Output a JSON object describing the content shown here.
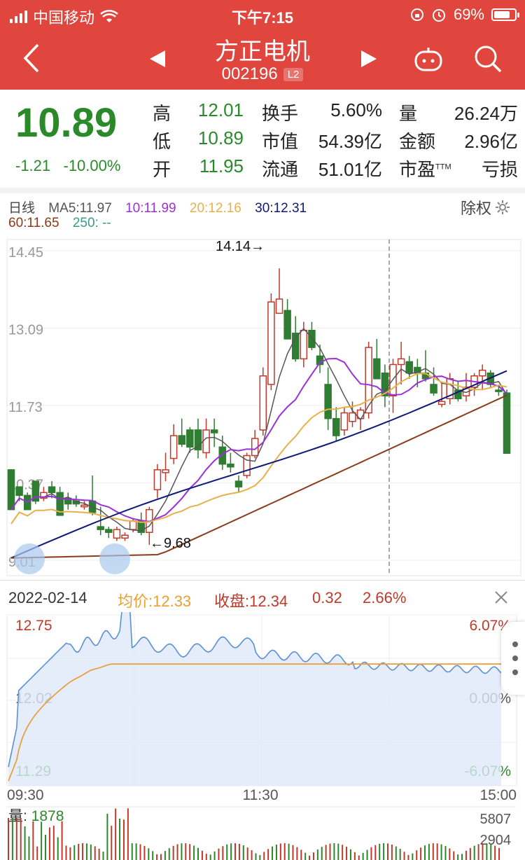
{
  "status": {
    "carrier": "中国移动",
    "time": "下午7:15",
    "battery": "69%"
  },
  "header": {
    "title": "方正电机",
    "code": "002196",
    "badge": "L2"
  },
  "quote": {
    "price": "10.89",
    "change": "-1.21",
    "change_pct": "-10.00%",
    "rows": [
      [
        {
          "l": "高",
          "v": "12.01",
          "c": "green"
        },
        {
          "l": "换手",
          "v": "5.60%",
          "c": "dark"
        },
        {
          "l": "量",
          "v": "26.24万",
          "c": "dark"
        }
      ],
      [
        {
          "l": "低",
          "v": "10.89",
          "c": "green"
        },
        {
          "l": "市值",
          "v": "54.39亿",
          "c": "dark"
        },
        {
          "l": "金额",
          "v": "2.96亿",
          "c": "dark"
        }
      ],
      [
        {
          "l": "开",
          "v": "11.95",
          "c": "green"
        },
        {
          "l": "流通",
          "v": "51.01亿",
          "c": "dark"
        },
        {
          "l": "市盈",
          "v": "亏损",
          "c": "dark",
          "sup": "TTM"
        }
      ]
    ]
  },
  "kline": {
    "period": "日线",
    "ma5": "MA5:11.97",
    "ma10": "10:11.99",
    "ma20": "20:12.16",
    "ma30": "30:12.31",
    "ma60": "60:11.65",
    "ma250": "250: --",
    "adjust": "除权",
    "axis": [
      "14.45",
      "13.09",
      "11.73",
      "10.37",
      "9.01"
    ],
    "high_note": "14.14→",
    "low_note": "←9.68",
    "colors": {
      "up": "#c0392b",
      "down": "#2e7d32",
      "ma5": "#555555",
      "ma10": "#9b30d9",
      "ma20": "#e8b04a",
      "ma30": "#0d1a7a",
      "ma60": "#8b3a1a"
    }
  },
  "intraday": {
    "date": "2022-02-14",
    "avg": "均价:12.33",
    "close": "收盘:12.34",
    "chg": "0.32",
    "pct": "2.66%",
    "left_axis": [
      "12.75",
      "12.02",
      "11.29"
    ],
    "right_axis": [
      "6.07%",
      "0.00%",
      "-6.07%"
    ],
    "times": [
      "09:30",
      "11:30",
      "15:00"
    ]
  },
  "volume": {
    "label": "量:",
    "value": "1878",
    "axis": [
      "5807",
      "2904"
    ]
  }
}
